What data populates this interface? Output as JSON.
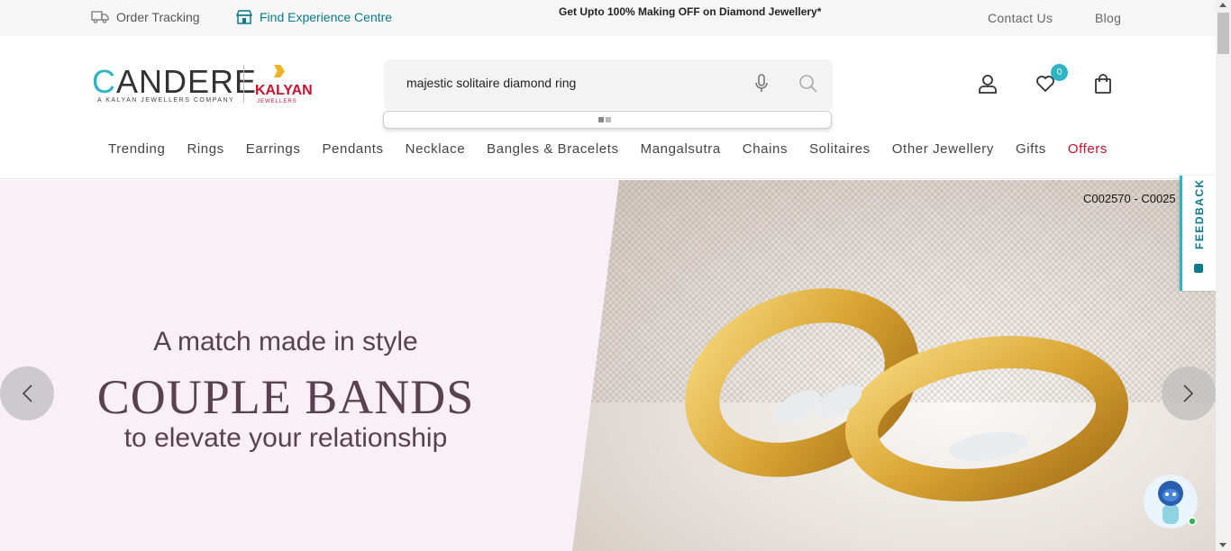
{
  "topbar": {
    "order_tracking": "Order Tracking",
    "find_experience": "Find Experience Centre",
    "promo": "Get Upto 100% Making OFF on Diamond Jewellery*",
    "contact": "Contact Us",
    "blog": "Blog"
  },
  "logo": {
    "brand_prefix": "C",
    "brand_rest": "ANDERE",
    "tagline": "A KALYAN JEWELLERS COMPANY",
    "partner": "KALYAN",
    "partner_sub": "JEWELLERS"
  },
  "search": {
    "value": "majestic solitaire diamond ring"
  },
  "header_icons": {
    "account": "user-icon",
    "wishlist": "heart-icon",
    "cart": "bag-icon",
    "wishlist_count": "0"
  },
  "nav": {
    "items": [
      "Trending",
      "Rings",
      "Earrings",
      "Pendants",
      "Necklace",
      "Bangles & Bracelets",
      "Mangalsutra",
      "Chains",
      "Solitaires",
      "Other Jewellery",
      "Gifts",
      "Offers"
    ]
  },
  "hero": {
    "line1": "A match made in style",
    "line2": "COUPLE BANDS",
    "line3": "to elevate your relationship",
    "product_code": "C002570 - C0025"
  },
  "feedback": {
    "label": "FEEDBACK"
  },
  "colors": {
    "accent": "#2fb4c5",
    "offers": "#c4122f",
    "hero_text": "#5a4150",
    "hero_bg": "#f8f0f6"
  }
}
